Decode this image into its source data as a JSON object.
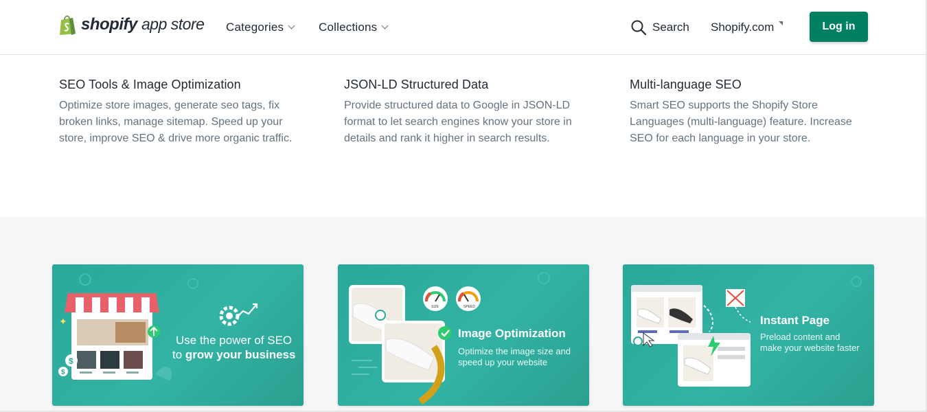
{
  "header": {
    "logo_bold": "shopify",
    "logo_light": "app store",
    "nav": [
      {
        "label": "Categories"
      },
      {
        "label": "Collections"
      }
    ],
    "search_label": "Search",
    "shopify_link": "Shopify.com",
    "login_label": "Log in"
  },
  "features": [
    {
      "title": "SEO Tools & Image Optimization",
      "desc": [
        "Optimize store images, generate seo tags, fix",
        "broken links, manage sitemap. Speed up your",
        "store, improve SEO & drive more organic traffic."
      ]
    },
    {
      "title": "JSON-LD Structured Data",
      "desc": [
        "Provide structured data to Google in JSON-LD",
        "format to let search engines know your store in",
        "details and rank it higher in search results."
      ]
    },
    {
      "title": "Multi-language SEO",
      "desc": [
        "Smart SEO supports the Shopify Store",
        "Languages (multi-language) feature. Increase",
        "SEO for each language in your store."
      ]
    }
  ],
  "gallery": [
    {
      "line1": "Use the power of SEO",
      "line2_prefix": "to ",
      "line2_bold": "grow your business"
    },
    {
      "title": "Image Optimization",
      "sub": [
        "Optimize the image size and",
        "speed up your website"
      ],
      "gauge1": "SIZE",
      "gauge2": "SPEED"
    },
    {
      "title": "Instant Page",
      "sub": [
        "Preload content and",
        "make your website faster"
      ]
    }
  ],
  "colors": {
    "brand_green": "#008060",
    "card_teal": "#2ea99b",
    "text_dark": "#212b36",
    "text_muted": "#637381"
  }
}
